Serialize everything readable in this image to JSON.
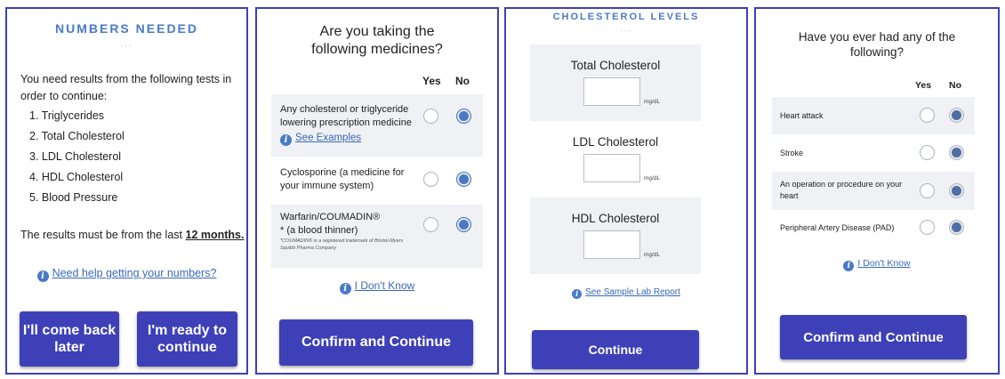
{
  "colors": {
    "accent": "#3e40b8",
    "heading": "#4a7ac6",
    "link": "#3a68b8",
    "row_shade": "#eff1f4"
  },
  "panel1": {
    "heading": "NUMBERS NEEDED",
    "dots": "...",
    "intro": "You need results from the following tests in order to continue:",
    "tests": [
      "1. Triglycerides",
      "2. Total Cholesterol",
      "3. LDL Cholesterol",
      "4. HDL Cholesterol",
      "5. Blood Pressure"
    ],
    "results_prefix": "The results must be from the last ",
    "results_emphasis": "12 months.",
    "help_link": "Need help getting your numbers?",
    "btn_later": "I'll come back later",
    "btn_ready": "I'm ready to continue"
  },
  "panel2": {
    "title": "Are you taking the following medicines?",
    "col_yes": "Yes",
    "col_no": "No",
    "rows": [
      {
        "text": "Any cholesterol or triglyceride lowering prescription medicine",
        "link": "See Examples",
        "answer": "No"
      },
      {
        "text": "Cyclosporine (a medicine for your immune system)",
        "answer": "No"
      },
      {
        "text": "Warfarin/COUMADIN® * (a blood thinner)",
        "footnote": "*COUMADIN® is a registered trademark of Bristol-Myers Squibb Pharma Company",
        "answer": "No"
      }
    ],
    "dont_know": "I Don't Know",
    "confirm": "Confirm and Continue"
  },
  "panel3": {
    "heading": "CHOLESTEROL LEVELS",
    "dots": "...",
    "fields": [
      {
        "label": "Total Cholesterol",
        "value": "",
        "unit": "mg/dL"
      },
      {
        "label": "LDL Cholesterol",
        "value": "",
        "unit": "mg/dL"
      },
      {
        "label": "HDL Cholesterol",
        "value": "",
        "unit": "mg/dL"
      }
    ],
    "sample_link": "See Sample Lab Report",
    "continue": "Continue"
  },
  "panel4": {
    "title": "Have you ever had any of the following?",
    "col_yes": "Yes",
    "col_no": "No",
    "rows": [
      {
        "text": "Heart attack",
        "answer": "No"
      },
      {
        "text": "Stroke",
        "answer": "No"
      },
      {
        "text": "An operation or procedure on your heart",
        "answer": "No"
      },
      {
        "text": "Peripheral Artery Disease (PAD)",
        "answer": "No"
      }
    ],
    "dont_know": "I Don't Know",
    "confirm": "Confirm and Continue"
  }
}
